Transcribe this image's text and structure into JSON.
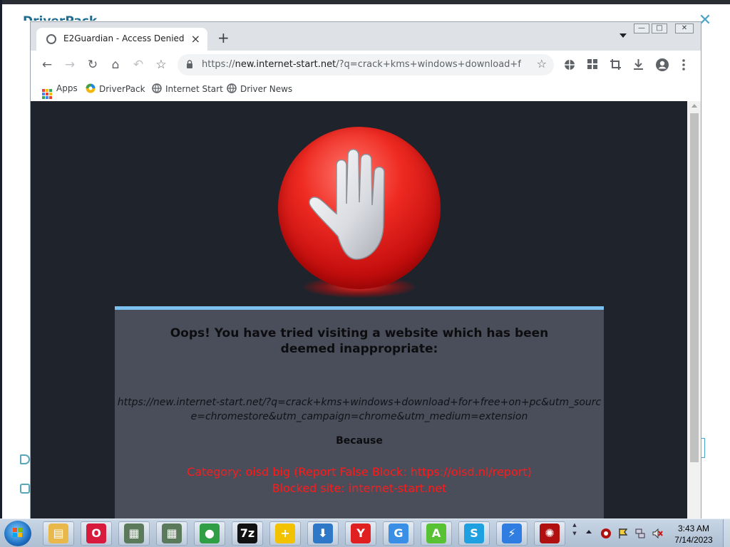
{
  "background_app": {
    "logo_text": "DriverPack"
  },
  "browser": {
    "tab": {
      "title": "E2Guardian - Access Denied",
      "close_symbol": "×"
    },
    "new_tab_symbol": "+",
    "window_controls": [
      "—",
      "□",
      "✕"
    ],
    "toolbar": {
      "back": "←",
      "forward": "→",
      "reload": "↻",
      "home": "⌂",
      "undo": "↶",
      "star": "☆",
      "extensions": [
        "puzzle-icon",
        "grid-icon",
        "crop-icon",
        "download-icon",
        "profile-icon",
        "menu-icon"
      ]
    },
    "address_bar": {
      "scheme": "https://",
      "host": "new.internet-start.net",
      "path": "/?q=crack+kms+windows+download+for..."
    },
    "bookmarks": [
      {
        "label": "Apps",
        "icon": "apps-grid-icon"
      },
      {
        "label": "DriverPack",
        "icon": "driverpack-icon"
      },
      {
        "label": "Internet Start",
        "icon": "globe-icon"
      },
      {
        "label": "Driver News",
        "icon": "globe-icon"
      }
    ]
  },
  "block_page": {
    "heading": "Oops! You have tried visiting a website which has been deemed inappropriate:",
    "blocked_url": "https://new.internet-start.net/?q=crack+kms+windows+download+for+free+on+pc&utm_source=chromestore&utm_campaign=chrome&utm_medium=extension",
    "because_label": "Because",
    "category_line": "Category: oisd big (Report False Block: https://oisd.nl/report)",
    "blocked_site_line": "Blocked site: internet-start.net",
    "accent_color": "#7cc0f0",
    "reason_color": "#ff1a1a"
  },
  "taskbar": {
    "apps": [
      {
        "name": "explorer",
        "glyph": "▤",
        "color": "#e8b84a"
      },
      {
        "name": "opera",
        "glyph": "O",
        "color": "#d81b3c"
      },
      {
        "name": "window-app-1",
        "glyph": "▦",
        "color": "#5b7a5b"
      },
      {
        "name": "window-app-2",
        "glyph": "▦",
        "color": "#5b7a5b"
      },
      {
        "name": "chrome",
        "glyph": "●",
        "color": "#2f9e44"
      },
      {
        "name": "7zip",
        "glyph": "7z",
        "color": "#111111"
      },
      {
        "name": "plus-app",
        "glyph": "+",
        "color": "#f2c200"
      },
      {
        "name": "downloader",
        "glyph": "⬇",
        "color": "#2e78c7"
      },
      {
        "name": "yandex",
        "glyph": "Y",
        "color": "#e02020"
      },
      {
        "name": "google-app",
        "glyph": "G",
        "color": "#3a8ee6"
      },
      {
        "name": "android-studio",
        "glyph": "A",
        "color": "#59c234"
      },
      {
        "name": "skype",
        "glyph": "S",
        "color": "#1fa0e0"
      },
      {
        "name": "thunder-app",
        "glyph": "⚡",
        "color": "#2f7de1"
      },
      {
        "name": "security-app",
        "glyph": "✺",
        "color": "#b01010"
      }
    ],
    "clock": {
      "time": "3:43 AM",
      "date": "7/14/2023"
    }
  }
}
